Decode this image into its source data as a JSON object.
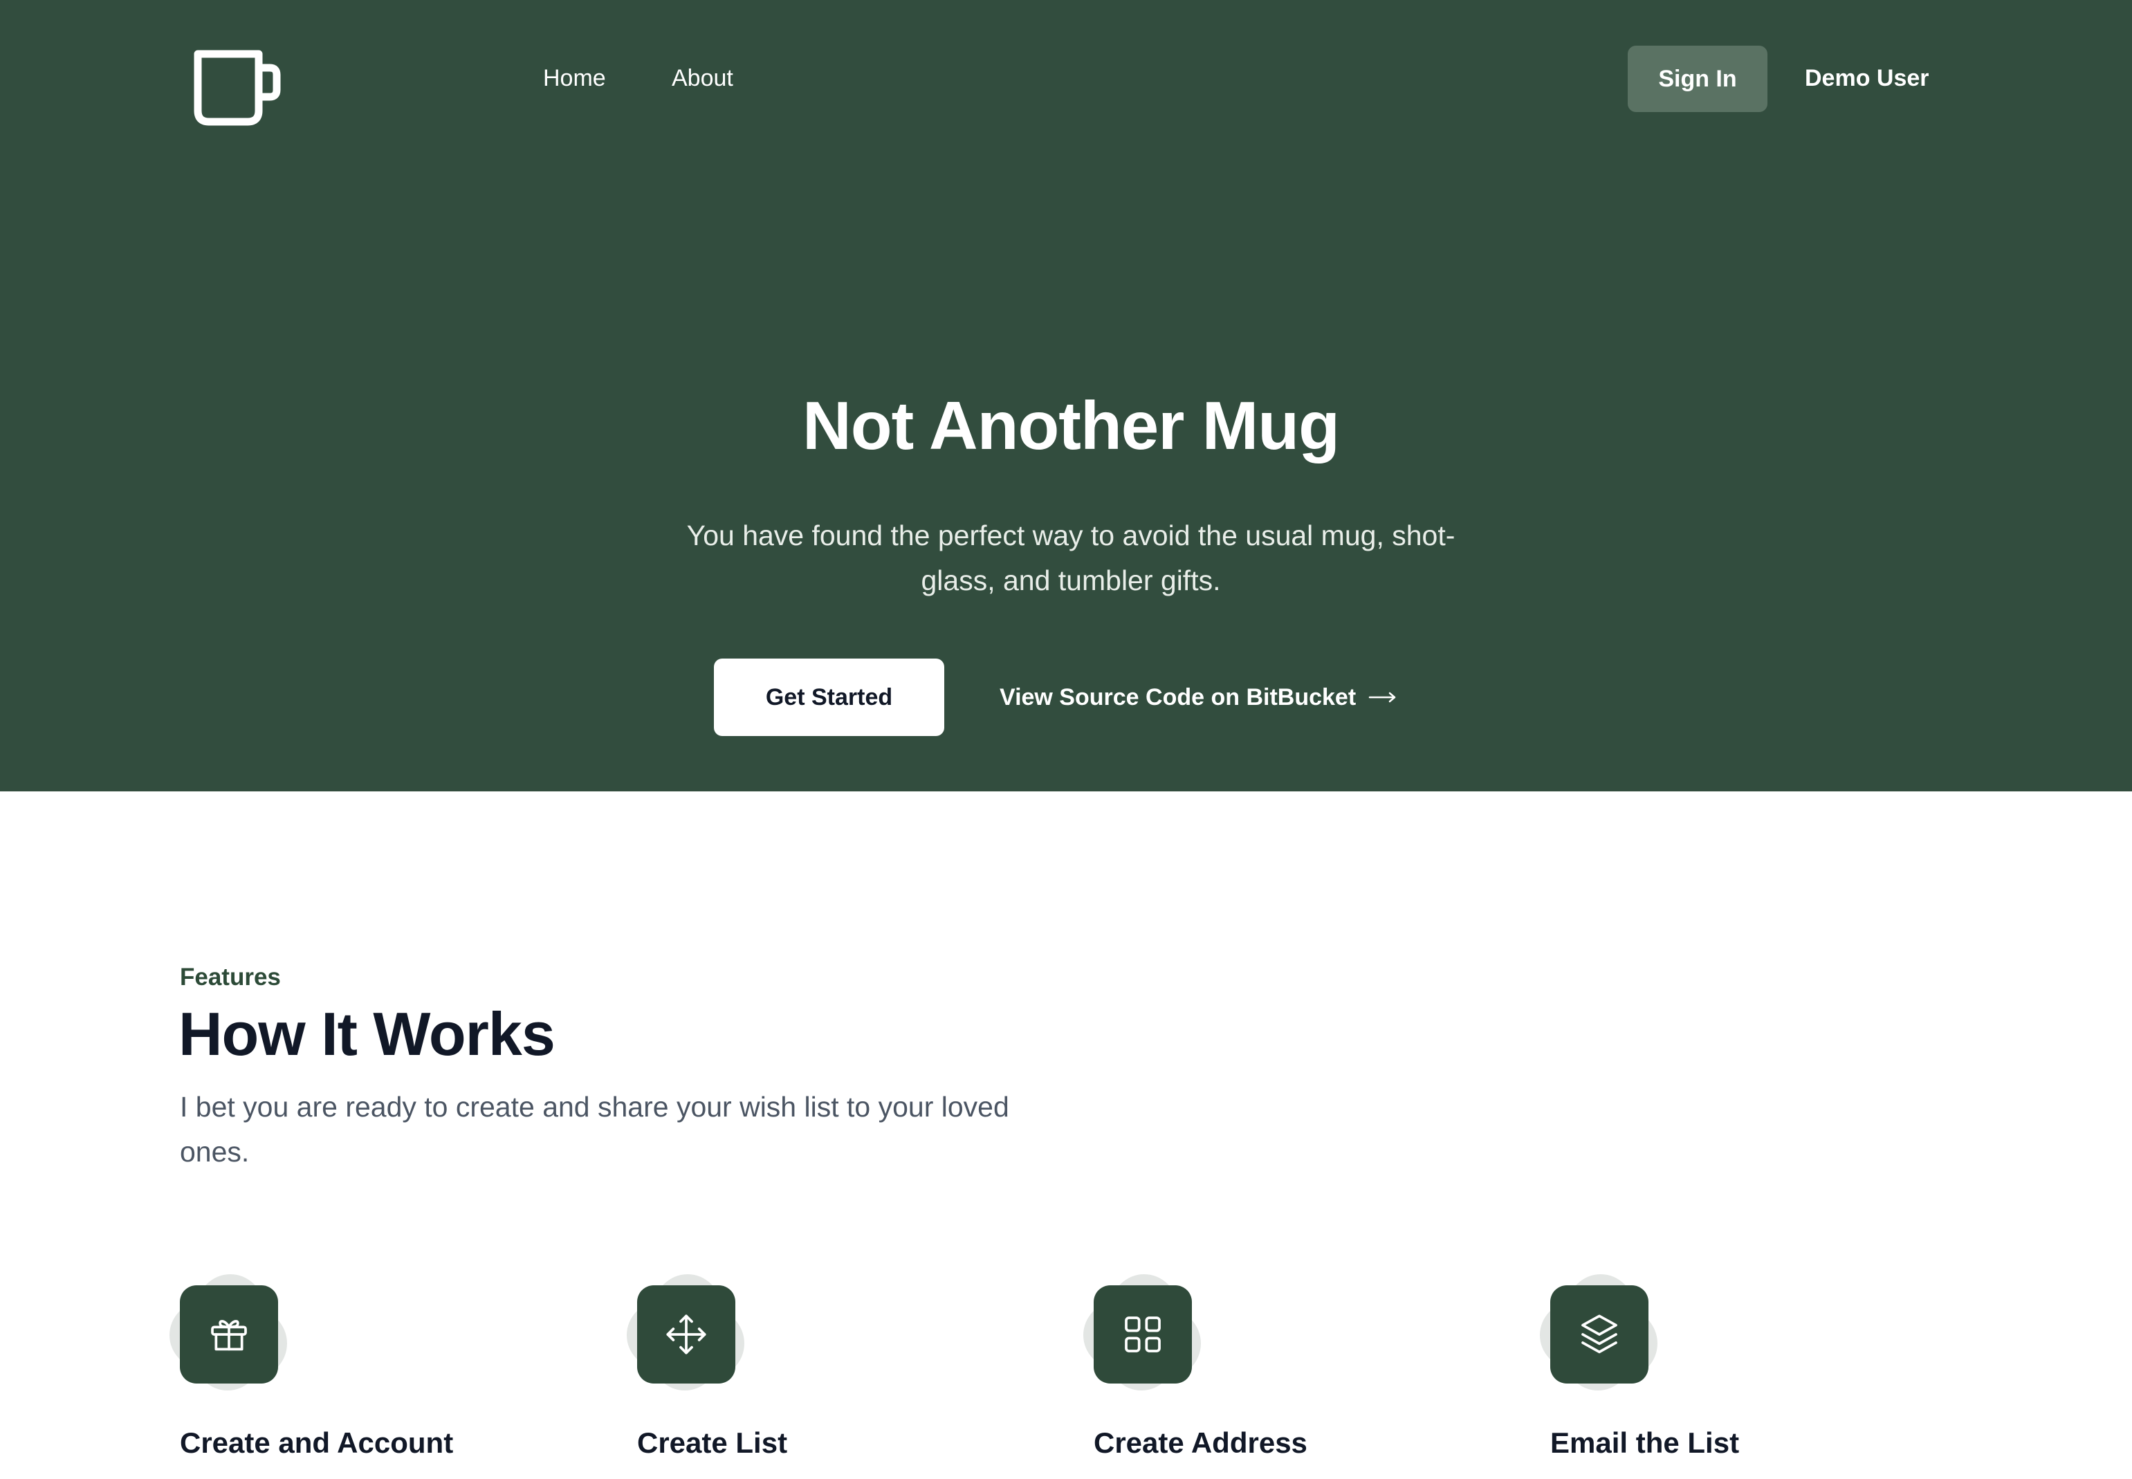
{
  "header": {
    "nav": [
      {
        "label": "Home"
      },
      {
        "label": "About"
      }
    ],
    "sign_in_label": "Sign In",
    "user_label": "Demo User",
    "logo_icon": "mug-icon"
  },
  "hero": {
    "title": "Not Another Mug",
    "subtitle": "You have found the perfect way to avoid the usual mug, shot-glass, and tumbler gifts.",
    "primary_cta": "Get Started",
    "secondary_cta": "View Source Code on BitBucket",
    "secondary_cta_icon": "arrow-right-icon"
  },
  "features": {
    "eyebrow": "Features",
    "title": "How It Works",
    "description": "I bet you are ready to create and share your wish list to your loved ones.",
    "items": [
      {
        "title": "Create and Account",
        "icon": "gift-icon"
      },
      {
        "title": "Create List",
        "icon": "move-icon"
      },
      {
        "title": "Create Address",
        "icon": "grid-icon"
      },
      {
        "title": "Email the List",
        "icon": "layers-icon"
      }
    ]
  },
  "colors": {
    "hero_background": "#324d3e",
    "icon_background": "#2f4a3a",
    "sign_in_background": "#5a7263",
    "heading_text": "#111827",
    "accent_text": "#2c4a37"
  }
}
